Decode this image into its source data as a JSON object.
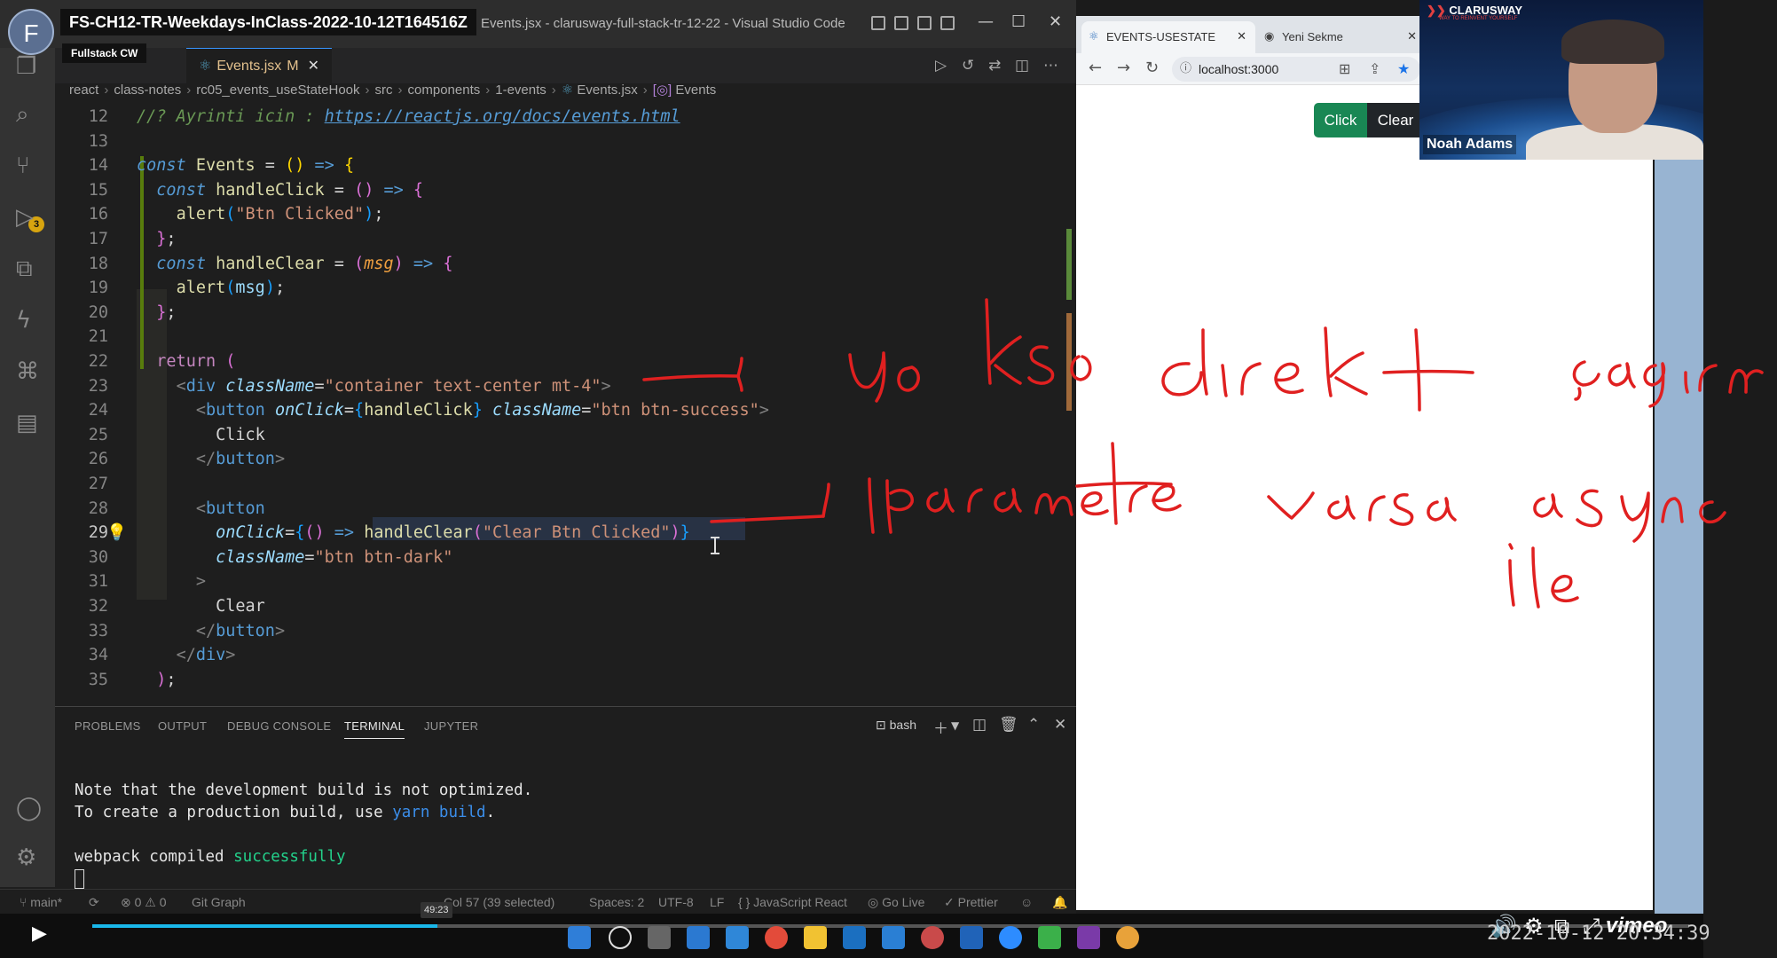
{
  "recording": {
    "avatar_letter": "F",
    "title": "FS-CH12-TR-Weekdays-InClass-2022-10-12T164516Z",
    "tag": "Fullstack CW"
  },
  "vscode": {
    "window_title": "Events.jsx - clarusway-full-stack-tr-12-22 - Visual Studio Code",
    "tab": {
      "label": "Events.jsx",
      "modified_marker": "M"
    },
    "breadcrumb": [
      "react",
      "class-notes",
      "rc05_events_useStateHook",
      "src",
      "components",
      "1-events",
      "Events.jsx",
      "Events"
    ],
    "scm_badge": "3",
    "code_lines": [
      {
        "n": "12"
      },
      {
        "n": "13"
      },
      {
        "n": "14"
      },
      {
        "n": "15"
      },
      {
        "n": "16"
      },
      {
        "n": "17"
      },
      {
        "n": "18"
      },
      {
        "n": "19"
      },
      {
        "n": "20"
      },
      {
        "n": "21"
      },
      {
        "n": "22"
      },
      {
        "n": "23"
      },
      {
        "n": "24"
      },
      {
        "n": "25"
      },
      {
        "n": "26"
      },
      {
        "n": "27"
      },
      {
        "n": "28"
      },
      {
        "n": "29"
      },
      {
        "n": "30"
      },
      {
        "n": "31"
      },
      {
        "n": "32"
      },
      {
        "n": "33"
      },
      {
        "n": "34"
      },
      {
        "n": "35"
      }
    ],
    "code": {
      "l12_comment": "//? Ayrinti icin : ",
      "l12_link": "https://reactjs.org/docs/events.html",
      "const": "const",
      "events": "Events",
      "handleClick": "handleClick",
      "handleClear": "handleClear",
      "alert": "alert",
      "btn_clicked": "\"Btn Clicked\"",
      "msg": "msg",
      "return": "return",
      "div": "div",
      "button": "button",
      "className": "className",
      "onClick": "onClick",
      "container_cls": "\"container text-center mt-4\"",
      "success_cls": "\"btn btn-success\"",
      "dark_cls": "\"btn btn-dark\"",
      "clear_btn_clicked": "\"Clear Btn Clicked\"",
      "click_text": "Click",
      "clear_text": "Clear"
    },
    "panel": {
      "tabs": [
        "PROBLEMS",
        "OUTPUT",
        "DEBUG CONSOLE",
        "TERMINAL",
        "JUPYTER"
      ],
      "shell": "bash",
      "terminal": {
        "line1": "Note that the development build is not optimized.",
        "line2_pre": "To create a production build, use ",
        "line2_cmd": "yarn build",
        "line2_post": ".",
        "line3_pre": "webpack compiled ",
        "line3_ok": "successfully"
      }
    },
    "statusbar": {
      "branch": "main*",
      "problems": "⊗ 0 ⚠ 0",
      "git_graph": "Git Graph",
      "position": "Col 57 (39 selected)",
      "spaces": "Spaces: 2",
      "encoding": "UTF-8",
      "eol": "LF",
      "language": "{ } JavaScript React",
      "golive": "Go Live",
      "prettier": "✓ Prettier"
    }
  },
  "browser": {
    "tabs": [
      {
        "label": "EVENTS-USESTATE"
      },
      {
        "label": "Yeni Sekme"
      }
    ],
    "url": "localhost:3000",
    "buttons": {
      "click": "Click",
      "clear": "Clear"
    }
  },
  "webcam": {
    "brand": "CLARUSWAY",
    "slogan": "WAY TO REINVENT YOURSELF",
    "name": "Noah Adams"
  },
  "annotations": {
    "line1": "yoksa direkt çağırma",
    "line2": "parametre varsa async",
    "line3": "ile"
  },
  "player": {
    "hover_time": "49:23",
    "timestamp": "2022-10-12 20:34:39",
    "brand": "vimeo",
    "progress_fraction": 0.216
  },
  "colors": {
    "success": "#198754",
    "dark": "#212529",
    "ink": "#e02020",
    "accent": "#1ab7ea"
  }
}
